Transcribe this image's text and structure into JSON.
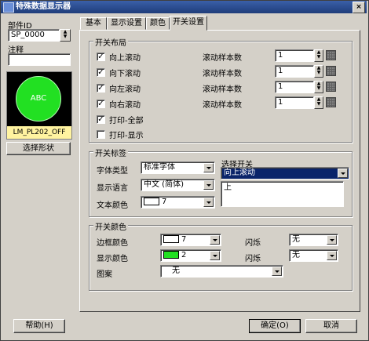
{
  "window": {
    "title": "特殊数据显示器",
    "close_label": "×"
  },
  "left": {
    "part_id_label": "部件ID",
    "part_id_value": "SP_0000",
    "comment_label": "注释",
    "comment_value": "",
    "preview_text": "ABC",
    "preview_caption": "LM_PL202_OFF",
    "select_shape_button": "选择形状"
  },
  "tabs": [
    {
      "label": "基本"
    },
    {
      "label": "显示设置"
    },
    {
      "label": "颜色"
    },
    {
      "label": "开关设置"
    }
  ],
  "switch_layout": {
    "title": "开关布局",
    "sample_label": "滚动样本数",
    "items": [
      {
        "label": "向上滚动",
        "checked": true,
        "sample": "1"
      },
      {
        "label": "向下滚动",
        "checked": true,
        "sample": "1"
      },
      {
        "label": "向左滚动",
        "checked": true,
        "sample": "1"
      },
      {
        "label": "向右滚动",
        "checked": true,
        "sample": "1"
      },
      {
        "label": "打印-全部",
        "checked": true
      },
      {
        "label": "打印-显示",
        "checked": false
      }
    ]
  },
  "switch_label": {
    "title": "开关标签",
    "font_type_label": "字体类型",
    "font_type_value": "标准字体",
    "language_label": "显示语言",
    "language_value": "中文 (简体)",
    "text_color_label": "文本颜色",
    "text_color_value": "7",
    "select_switch_label": "选择开关",
    "select_switch_value": "向上滚动",
    "label_text": "上"
  },
  "switch_color": {
    "title": "开关颜色",
    "border_color_label": "边框颜色",
    "border_color_value": "7",
    "display_color_label": "显示颜色",
    "display_color_value": "2",
    "blink1_label": "闪烁",
    "blink1_value": "无",
    "blink2_label": "闪烁",
    "blink2_value": "无",
    "pattern_label": "图案",
    "pattern_value": "无"
  },
  "footer": {
    "help_button": "帮助(H)",
    "ok_button": "确定(O)",
    "cancel_button": "取消"
  },
  "colors": {
    "title_bar": "#1f3d7a",
    "preview_green": "#22e022",
    "caption_bg": "#fff3a0",
    "highlight": "#0a246a"
  }
}
